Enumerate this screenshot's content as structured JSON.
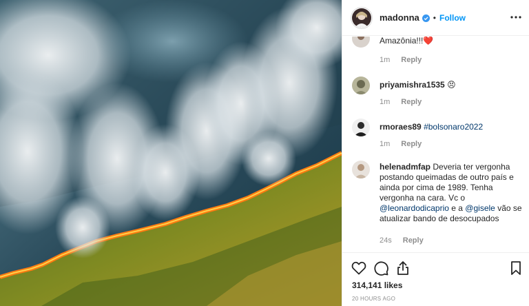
{
  "post": {
    "username": "madonna",
    "follow_label": "Follow",
    "separator": "•",
    "likes": "314,141 likes",
    "timestamp": "20 HOURS AGO"
  },
  "comments": [
    {
      "username": "",
      "text": "Amazônia!!!❤️",
      "mentions": [],
      "age": "1m",
      "reply_label": "Reply"
    },
    {
      "username": "priyamishra1535",
      "text": "😣",
      "mentions": [],
      "age": "1m",
      "reply_label": "Reply"
    },
    {
      "username": "rmoraes89",
      "text": "#bolsonaro2022",
      "mentions": [],
      "age": "1m",
      "reply_label": "Reply"
    },
    {
      "username": "helenadmfap",
      "text_1": "Deveria ter vergonha postando queimadas de outro país e ainda por cima de 1989. Tenha vergonha na cara. Vc o",
      "mention_1": "@leonardodicaprio",
      "text_2": "e a",
      "mention_2": "@gisele",
      "text_3": "vão se atualizar bando de desocupados",
      "age": "24s",
      "reply_label": "Reply"
    }
  ],
  "colors": {
    "accent": "#0095f6",
    "link": "#00376b",
    "muted": "#8e8e8e",
    "border": "#efefef"
  },
  "icons": {
    "like": "heart-icon",
    "comment": "comment-bubble-icon",
    "share": "share-icon",
    "save": "bookmark-icon",
    "more": "more-options-icon",
    "verified": "verified-badge-icon"
  }
}
